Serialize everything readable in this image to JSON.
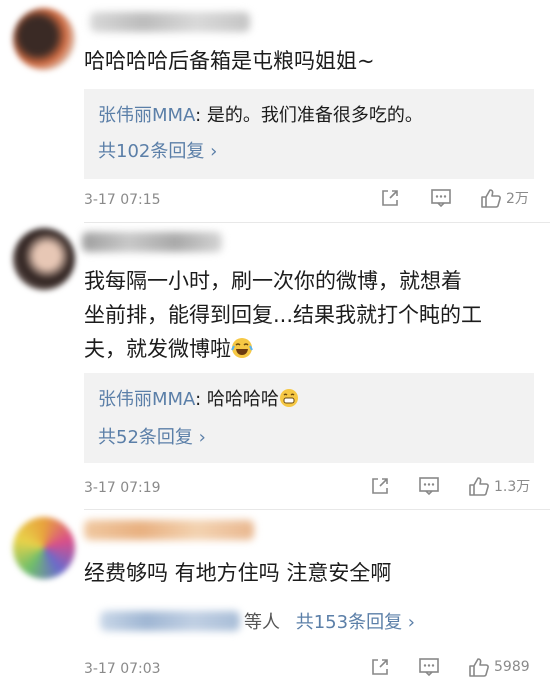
{
  "comments": [
    {
      "text": "哈哈哈哈后备箱是屯粮吗姐姐~",
      "reply": {
        "author": "张伟丽MMA",
        "colon": ": ",
        "text": "是的。我们准备很多吃的。"
      },
      "reply_count": "共102条回复 ›",
      "time": "3-17 07:15",
      "likes": "2万"
    },
    {
      "text_lines": [
        "我每隔一小时，刷一次你的微博，就想着",
        "坐前排，能得到回复...结果我就打个盹的工",
        "夫，就发微博啦"
      ],
      "reply": {
        "author": "张伟丽MMA",
        "colon": ": ",
        "text": "哈哈哈哈"
      },
      "reply_count": "共52条回复 ›",
      "time": "3-17 07:19",
      "likes": "1.3万"
    },
    {
      "text": "经费够吗 有地方住吗 注意安全啊",
      "others_suffix": "等人",
      "reply_count": "共153条回复 ›",
      "time": "3-17 07:03",
      "likes": "5989"
    }
  ],
  "icons": [
    "share-icon",
    "comment-icon",
    "like-icon",
    "laugh-cry-emoji-icon",
    "grin-emoji-icon"
  ],
  "colors": {
    "link": "#5b7fa8",
    "reply_bg": "#f2f2f2",
    "meta": "#8a8a8a"
  }
}
